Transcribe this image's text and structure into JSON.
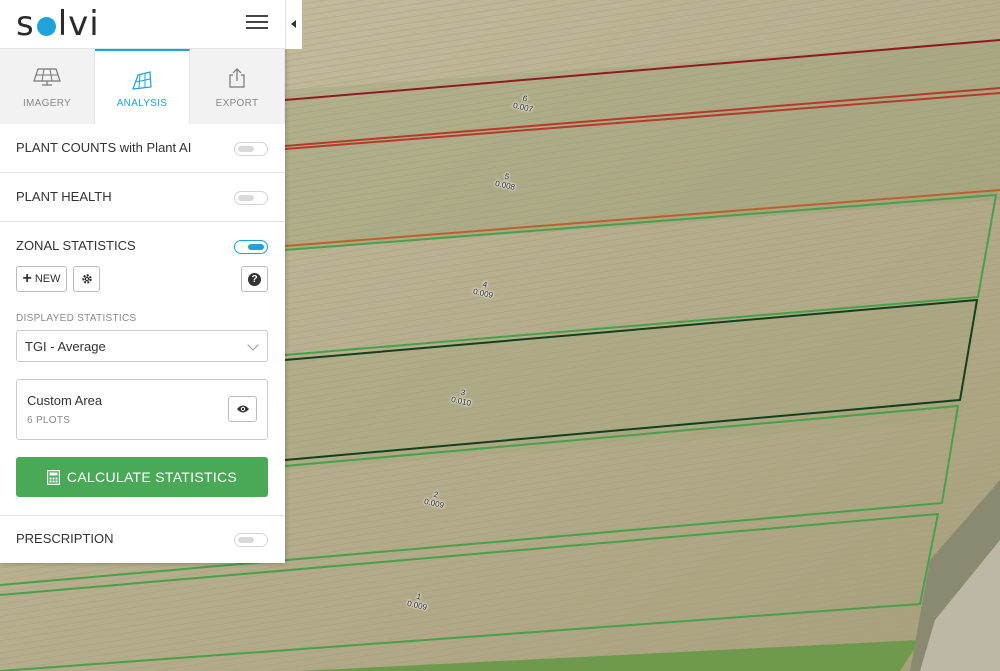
{
  "app": {
    "logo": "solvi"
  },
  "tabs": [
    {
      "label": "IMAGERY",
      "icon": "solar-panel-icon"
    },
    {
      "label": "ANALYSIS",
      "icon": "analysis-icon"
    },
    {
      "label": "EXPORT",
      "icon": "export-icon"
    }
  ],
  "sections": {
    "plant_counts": {
      "title": "PLANT COUNTS with Plant AI",
      "enabled": false
    },
    "plant_health": {
      "title": "PLANT HEALTH",
      "enabled": false
    },
    "zonal_statistics": {
      "title": "ZONAL STATISTICS",
      "enabled": true
    },
    "prescription": {
      "title": "PRESCRIPTION",
      "enabled": false
    }
  },
  "zonal": {
    "new_label": "NEW",
    "displayed_statistics_label": "DISPLAYED STATISTICS",
    "selected_statistic": "TGI - Average",
    "area": {
      "title": "Custom Area",
      "subtitle": "6 PLOTS"
    },
    "calculate_label": "CALCULATE STATISTICS"
  },
  "plots": [
    {
      "id": "6",
      "value": "0.007"
    },
    {
      "id": "5",
      "value": "0.008"
    },
    {
      "id": "4",
      "value": "0.009"
    },
    {
      "id": "3",
      "value": "0.010"
    },
    {
      "id": "2",
      "value": "0.009"
    },
    {
      "id": "1",
      "value": "0.009"
    }
  ],
  "colors": {
    "accent": "#1fa3dd",
    "calculate": "#4aa957",
    "plot_dark_red": "#8e1b20",
    "plot_red": "#b43b2a",
    "plot_orange": "#b8632e",
    "plot_green": "#49a04a",
    "plot_dark_green": "#123f1c"
  }
}
